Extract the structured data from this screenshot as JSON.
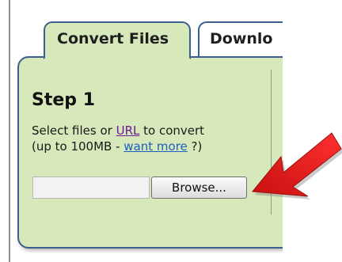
{
  "tabs": {
    "convert_label": "Convert Files",
    "download_label": "Downlo"
  },
  "step": {
    "title": "Step 1",
    "line1_prefix": "Select files or ",
    "line1_link": "URL",
    "line1_suffix": " to convert",
    "line2_prefix": "(up to 100MB - ",
    "line2_link": "want more",
    "line2_suffix": " ?)"
  },
  "upload": {
    "file_value": "",
    "browse_label": "Browse..."
  },
  "colors": {
    "panel_bg": "#d7e8ba",
    "panel_border": "#3b5f8f",
    "arrow": "#e31b1b"
  },
  "icons": {
    "arrow": "red-arrow-icon"
  }
}
